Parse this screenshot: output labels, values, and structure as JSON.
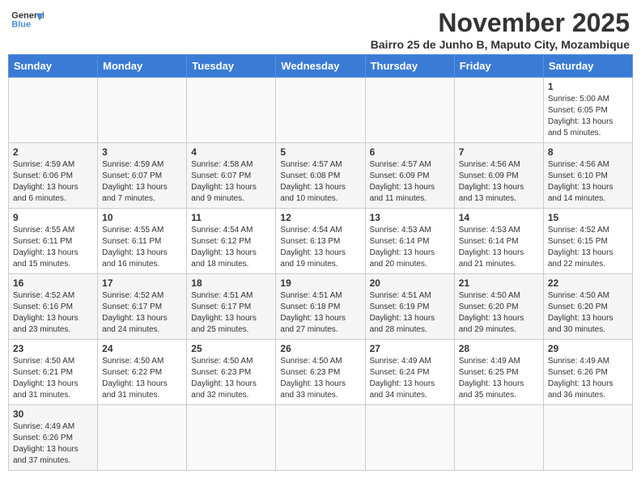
{
  "header": {
    "logo_general": "General",
    "logo_blue": "Blue",
    "month_title": "November 2025",
    "subtitle": "Bairro 25 de Junho B, Maputo City, Mozambique"
  },
  "weekdays": [
    "Sunday",
    "Monday",
    "Tuesday",
    "Wednesday",
    "Thursday",
    "Friday",
    "Saturday"
  ],
  "weeks": [
    [
      {
        "day": "",
        "info": ""
      },
      {
        "day": "",
        "info": ""
      },
      {
        "day": "",
        "info": ""
      },
      {
        "day": "",
        "info": ""
      },
      {
        "day": "",
        "info": ""
      },
      {
        "day": "",
        "info": ""
      },
      {
        "day": "1",
        "info": "Sunrise: 5:00 AM\nSunset: 6:05 PM\nDaylight: 13 hours and 5 minutes."
      }
    ],
    [
      {
        "day": "2",
        "info": "Sunrise: 4:59 AM\nSunset: 6:06 PM\nDaylight: 13 hours and 6 minutes."
      },
      {
        "day": "3",
        "info": "Sunrise: 4:59 AM\nSunset: 6:07 PM\nDaylight: 13 hours and 7 minutes."
      },
      {
        "day": "4",
        "info": "Sunrise: 4:58 AM\nSunset: 6:07 PM\nDaylight: 13 hours and 9 minutes."
      },
      {
        "day": "5",
        "info": "Sunrise: 4:57 AM\nSunset: 6:08 PM\nDaylight: 13 hours and 10 minutes."
      },
      {
        "day": "6",
        "info": "Sunrise: 4:57 AM\nSunset: 6:09 PM\nDaylight: 13 hours and 11 minutes."
      },
      {
        "day": "7",
        "info": "Sunrise: 4:56 AM\nSunset: 6:09 PM\nDaylight: 13 hours and 13 minutes."
      },
      {
        "day": "8",
        "info": "Sunrise: 4:56 AM\nSunset: 6:10 PM\nDaylight: 13 hours and 14 minutes."
      }
    ],
    [
      {
        "day": "9",
        "info": "Sunrise: 4:55 AM\nSunset: 6:11 PM\nDaylight: 13 hours and 15 minutes."
      },
      {
        "day": "10",
        "info": "Sunrise: 4:55 AM\nSunset: 6:11 PM\nDaylight: 13 hours and 16 minutes."
      },
      {
        "day": "11",
        "info": "Sunrise: 4:54 AM\nSunset: 6:12 PM\nDaylight: 13 hours and 18 minutes."
      },
      {
        "day": "12",
        "info": "Sunrise: 4:54 AM\nSunset: 6:13 PM\nDaylight: 13 hours and 19 minutes."
      },
      {
        "day": "13",
        "info": "Sunrise: 4:53 AM\nSunset: 6:14 PM\nDaylight: 13 hours and 20 minutes."
      },
      {
        "day": "14",
        "info": "Sunrise: 4:53 AM\nSunset: 6:14 PM\nDaylight: 13 hours and 21 minutes."
      },
      {
        "day": "15",
        "info": "Sunrise: 4:52 AM\nSunset: 6:15 PM\nDaylight: 13 hours and 22 minutes."
      }
    ],
    [
      {
        "day": "16",
        "info": "Sunrise: 4:52 AM\nSunset: 6:16 PM\nDaylight: 13 hours and 23 minutes."
      },
      {
        "day": "17",
        "info": "Sunrise: 4:52 AM\nSunset: 6:17 PM\nDaylight: 13 hours and 24 minutes."
      },
      {
        "day": "18",
        "info": "Sunrise: 4:51 AM\nSunset: 6:17 PM\nDaylight: 13 hours and 25 minutes."
      },
      {
        "day": "19",
        "info": "Sunrise: 4:51 AM\nSunset: 6:18 PM\nDaylight: 13 hours and 27 minutes."
      },
      {
        "day": "20",
        "info": "Sunrise: 4:51 AM\nSunset: 6:19 PM\nDaylight: 13 hours and 28 minutes."
      },
      {
        "day": "21",
        "info": "Sunrise: 4:50 AM\nSunset: 6:20 PM\nDaylight: 13 hours and 29 minutes."
      },
      {
        "day": "22",
        "info": "Sunrise: 4:50 AM\nSunset: 6:20 PM\nDaylight: 13 hours and 30 minutes."
      }
    ],
    [
      {
        "day": "23",
        "info": "Sunrise: 4:50 AM\nSunset: 6:21 PM\nDaylight: 13 hours and 31 minutes."
      },
      {
        "day": "24",
        "info": "Sunrise: 4:50 AM\nSunset: 6:22 PM\nDaylight: 13 hours and 31 minutes."
      },
      {
        "day": "25",
        "info": "Sunrise: 4:50 AM\nSunset: 6:23 PM\nDaylight: 13 hours and 32 minutes."
      },
      {
        "day": "26",
        "info": "Sunrise: 4:50 AM\nSunset: 6:23 PM\nDaylight: 13 hours and 33 minutes."
      },
      {
        "day": "27",
        "info": "Sunrise: 4:49 AM\nSunset: 6:24 PM\nDaylight: 13 hours and 34 minutes."
      },
      {
        "day": "28",
        "info": "Sunrise: 4:49 AM\nSunset: 6:25 PM\nDaylight: 13 hours and 35 minutes."
      },
      {
        "day": "29",
        "info": "Sunrise: 4:49 AM\nSunset: 6:26 PM\nDaylight: 13 hours and 36 minutes."
      }
    ],
    [
      {
        "day": "30",
        "info": "Sunrise: 4:49 AM\nSunset: 6:26 PM\nDaylight: 13 hours and 37 minutes."
      },
      {
        "day": "",
        "info": ""
      },
      {
        "day": "",
        "info": ""
      },
      {
        "day": "",
        "info": ""
      },
      {
        "day": "",
        "info": ""
      },
      {
        "day": "",
        "info": ""
      },
      {
        "day": "",
        "info": ""
      }
    ]
  ]
}
